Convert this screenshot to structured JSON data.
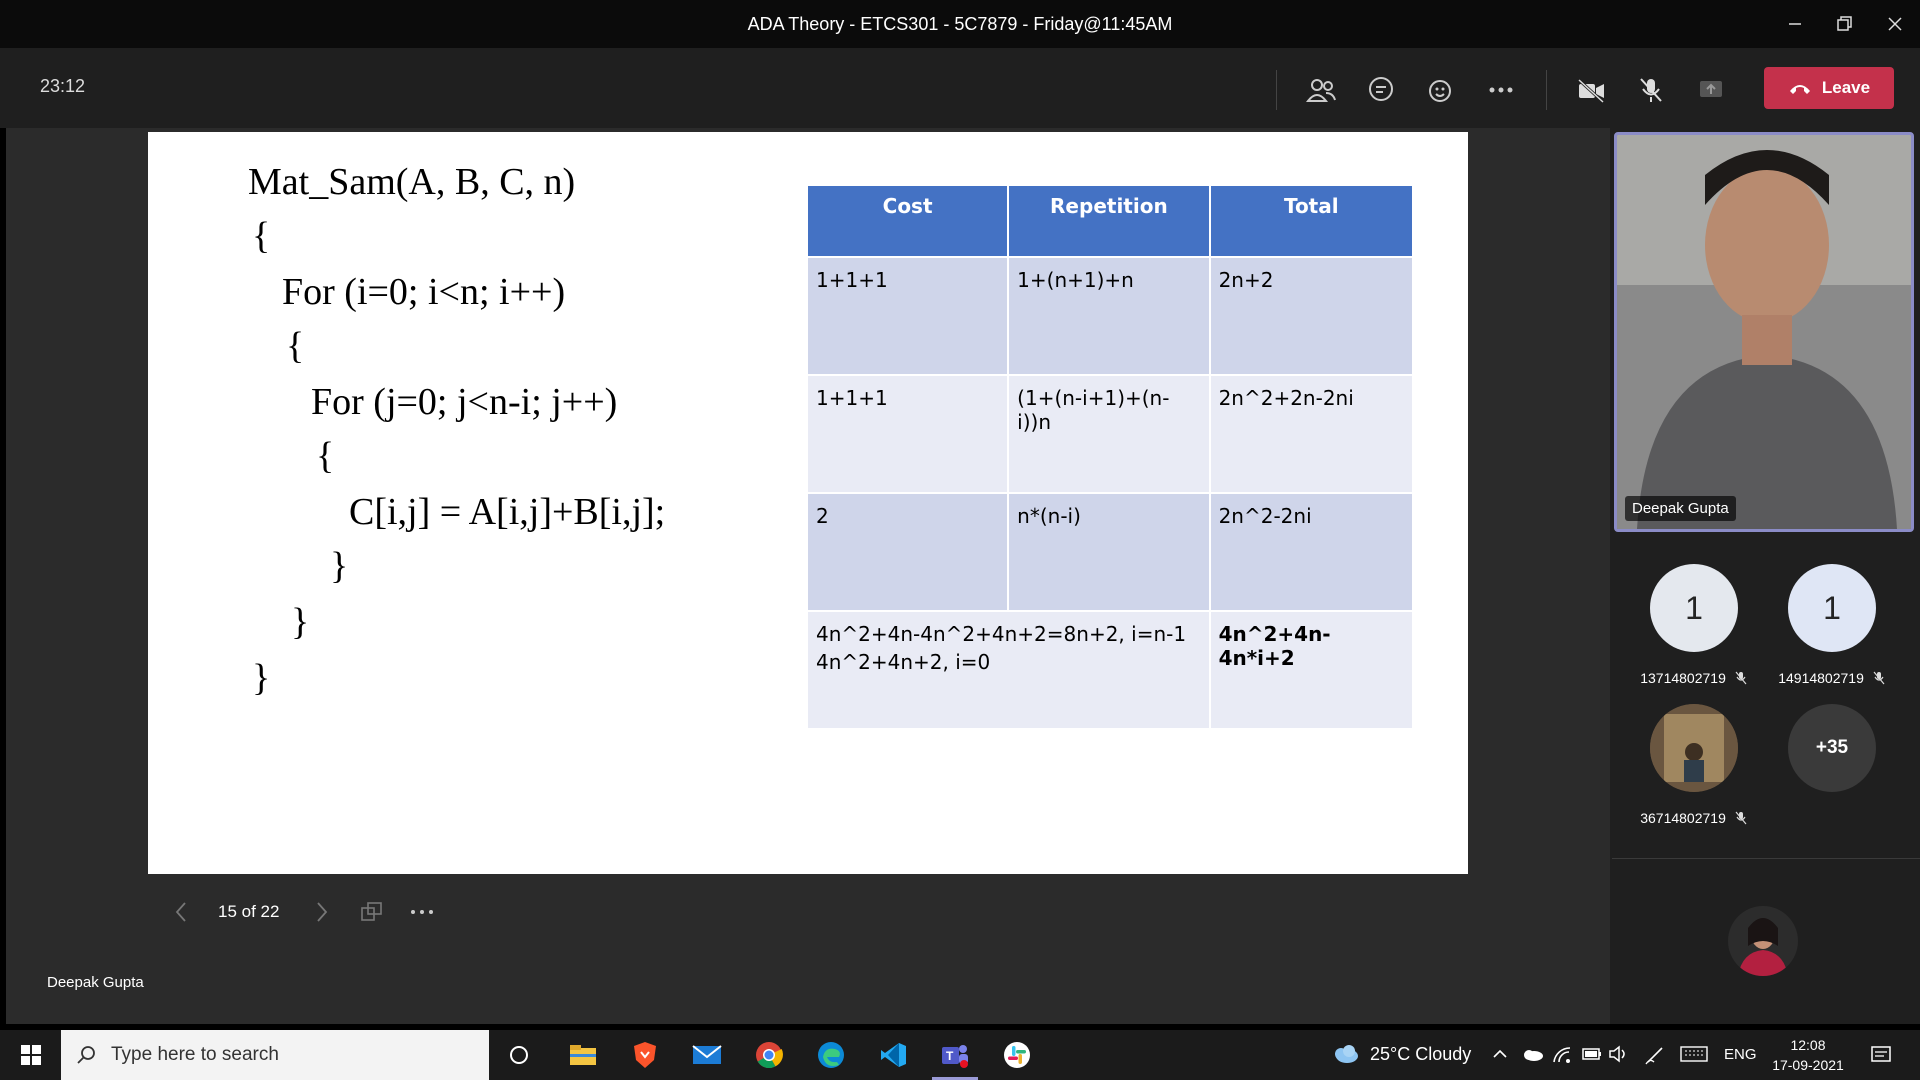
{
  "window": {
    "title": "ADA Theory - ETCS301 - 5C7879 - Friday@11:45AM"
  },
  "toolbar": {
    "timer": "23:12",
    "leave_label": "Leave"
  },
  "slide": {
    "code_lines": [
      "Mat_Sam(A, B, C, n)",
      "{",
      "For (i=0; i<n; i++)",
      "{",
      "For (j=0; j<n-i; j++)",
      "{",
      "C[i,j] = A[i,j]+B[i,j];",
      "}",
      "}",
      "}"
    ],
    "table": {
      "headers": [
        "Cost",
        "Repetition",
        "Total"
      ],
      "rows": [
        [
          "1+1+1",
          "1+(n+1)+n",
          "2n+2"
        ],
        [
          "1+1+1",
          "(1+(n-i+1)+(n-i))n",
          "2n^2+2n-2ni"
        ],
        [
          "2",
          "n*(n-i)",
          "2n^2-2ni"
        ]
      ],
      "summary_line1": "4n^2+4n-4n^2+4n+2=8n+2, i=n-1",
      "summary_line2": "4n^2+4n+2, i=0",
      "summary_total": "4n^2+4n-4n*i+2"
    },
    "page_indicator": "15 of 22"
  },
  "presenter": {
    "name": "Deepak Gupta",
    "video_label": "Deepak Gupta"
  },
  "participants": [
    {
      "initial": "1",
      "name": "13714802719"
    },
    {
      "initial": "1",
      "name": "14914802719"
    },
    {
      "name": "36714802719"
    }
  ],
  "more_participants": "+35",
  "taskbar": {
    "search_placeholder": "Type here to search",
    "weather": "25°C  Cloudy",
    "language": "ENG",
    "time": "12:08",
    "date": "17-09-2021"
  },
  "colors": {
    "leave": "#c4314b",
    "table_header": "#4472c4",
    "video_border": "#8b8cc7"
  }
}
